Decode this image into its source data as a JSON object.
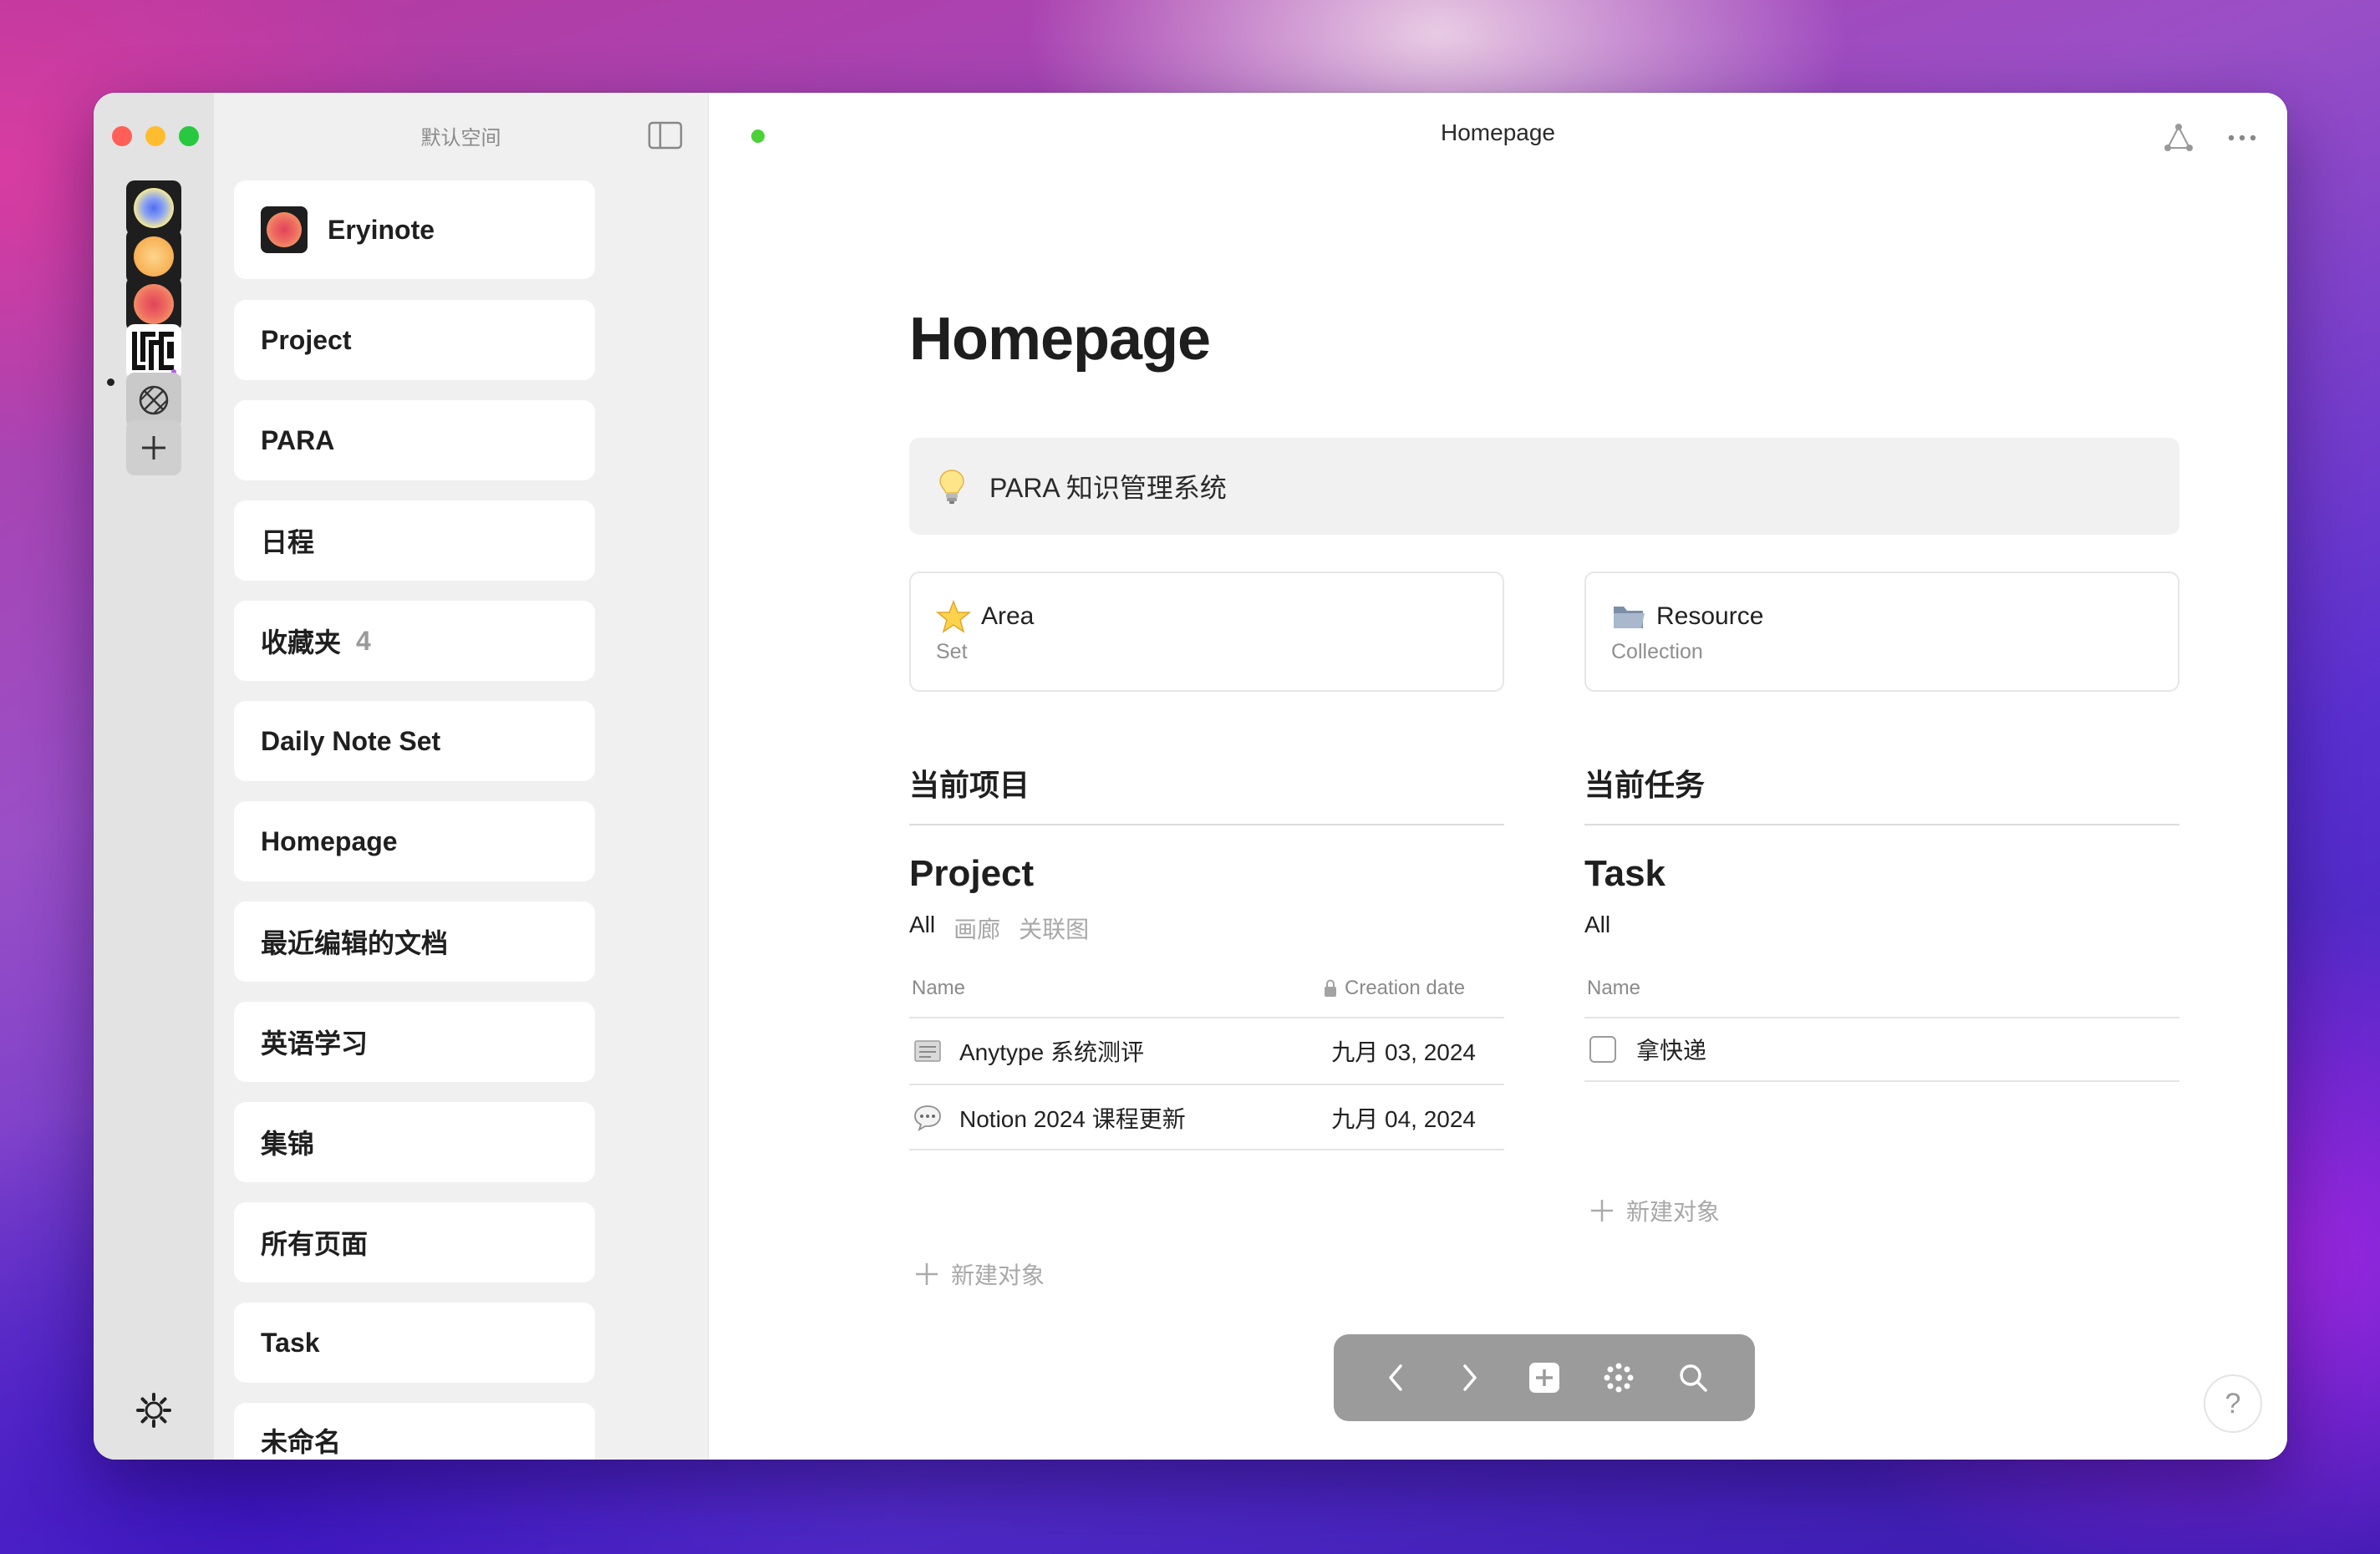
{
  "window": {
    "title": "Homepage"
  },
  "rail": {
    "spaces": [
      {
        "name": "space-blue-orb",
        "icon": "blue-orb"
      },
      {
        "name": "space-yellow-orb",
        "icon": "yellow-orb"
      },
      {
        "name": "space-red-orb",
        "icon": "red-orb",
        "active": true
      },
      {
        "name": "space-lfc",
        "icon": "lfc-logo"
      },
      {
        "name": "space-grey",
        "icon": "crossed-circle-icon"
      }
    ],
    "add_icon": "plus-icon",
    "settings_icon": "gear-icon"
  },
  "sidebar": {
    "space_name": "默认空间",
    "toggle_icon": "sidebar-toggle-icon",
    "header_item": {
      "label": "Eryinote",
      "icon": "red-orb"
    },
    "items": [
      {
        "label": "Project"
      },
      {
        "label": "PARA"
      },
      {
        "label": "日程"
      },
      {
        "label": "收藏夹",
        "count": "4"
      },
      {
        "label": "Daily Note Set"
      },
      {
        "label": "Homepage"
      },
      {
        "label": "最近编辑的文档"
      },
      {
        "label": "英语学习"
      },
      {
        "label": "集锦"
      },
      {
        "label": "所有页面"
      },
      {
        "label": "Task"
      },
      {
        "label": "未命名"
      }
    ]
  },
  "page": {
    "title": "Homepage",
    "callout": {
      "icon": "lightbulb-icon",
      "text": "PARA 知识管理系统"
    },
    "cards": [
      {
        "icon": "star-icon",
        "title": "Area",
        "subtitle": "Set"
      },
      {
        "icon": "folder-icon",
        "title": "Resource",
        "subtitle": "Collection"
      }
    ],
    "left_section": {
      "heading": "当前项目",
      "set_title": "Project",
      "views": [
        "All",
        "画廊",
        "关联图"
      ],
      "columns": [
        "Name",
        "Creation date"
      ],
      "rows": [
        {
          "icon": "document-icon",
          "name": "Anytype 系统测评",
          "date": "九月 03, 2024"
        },
        {
          "icon": "speech-bubble-icon",
          "name": "Notion 2024 课程更新",
          "date": "九月 04, 2024"
        }
      ],
      "new_object": "新建对象"
    },
    "right_section": {
      "heading": "当前任务",
      "set_title": "Task",
      "views": [
        "All"
      ],
      "columns": [
        "Name"
      ],
      "rows": [
        {
          "name": "拿快递",
          "checked": false
        }
      ],
      "new_object": "新建对象"
    }
  },
  "bottom_bar": {
    "buttons": [
      "back-icon",
      "forward-icon",
      "add-icon",
      "graph-dots-icon",
      "search-icon"
    ]
  },
  "help": {
    "label": "?"
  },
  "colors": {
    "sync_dot": "#4cd137",
    "accent_text": "#1f1f1f",
    "muted_text": "#8a8a8a"
  }
}
